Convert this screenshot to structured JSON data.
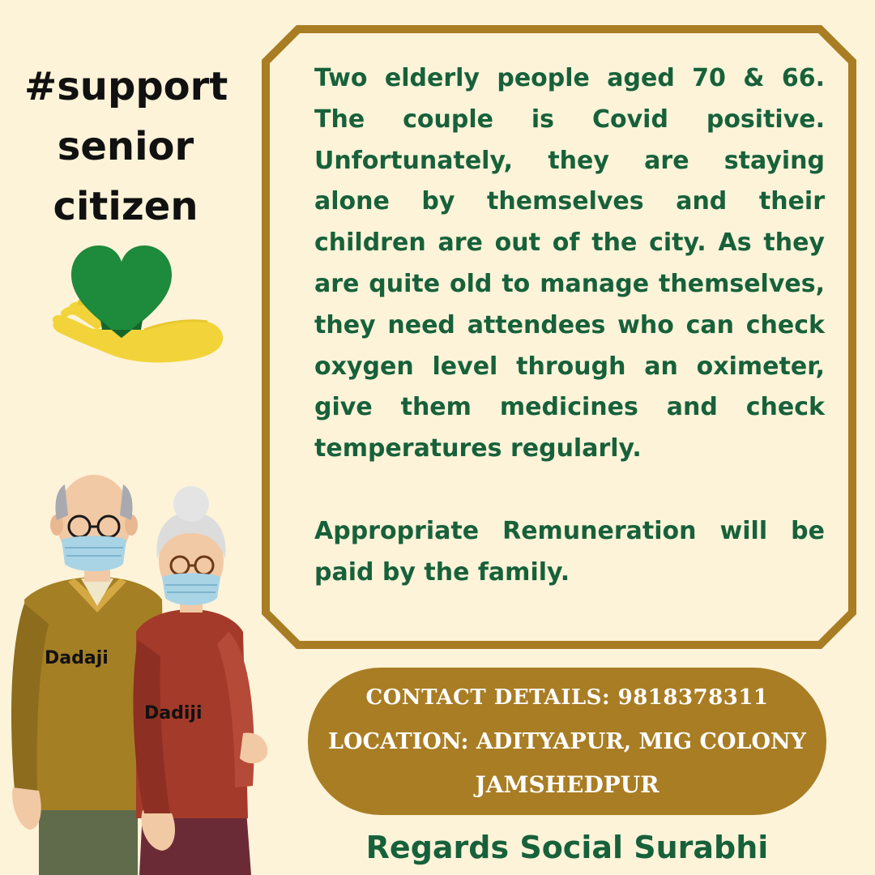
{
  "hashtag": {
    "line1": "#support",
    "line2": "senior",
    "line3": "citizen"
  },
  "message": {
    "paragraph1": "Two elderly people aged 70 & 66. The couple is Covid positive. Unfortunately, they are staying alone by themselves and their children are out of the city. As they are quite old to manage themselves, they need attendees who can check oxygen level through an oximeter, give them medicines and check temperatures regularly.",
    "paragraph2": "Appropriate Remuneration will be paid by the family."
  },
  "figures": {
    "man_label": "Dadaji",
    "woman_label": "Dadiji"
  },
  "contact": {
    "line1": "CONTACT DETAILS: 9818378311",
    "line2": "LOCATION: ADITYAPUR, MIG COLONY",
    "line3": "JAMSHEDPUR"
  },
  "footer": {
    "regards": "Regards Social Surabhi"
  },
  "colors": {
    "background": "#fdf3d9",
    "frame": "#a97d24",
    "text_green": "#17613a",
    "heart_green": "#1e8a3c",
    "hand_yellow": "#f2d43a"
  }
}
